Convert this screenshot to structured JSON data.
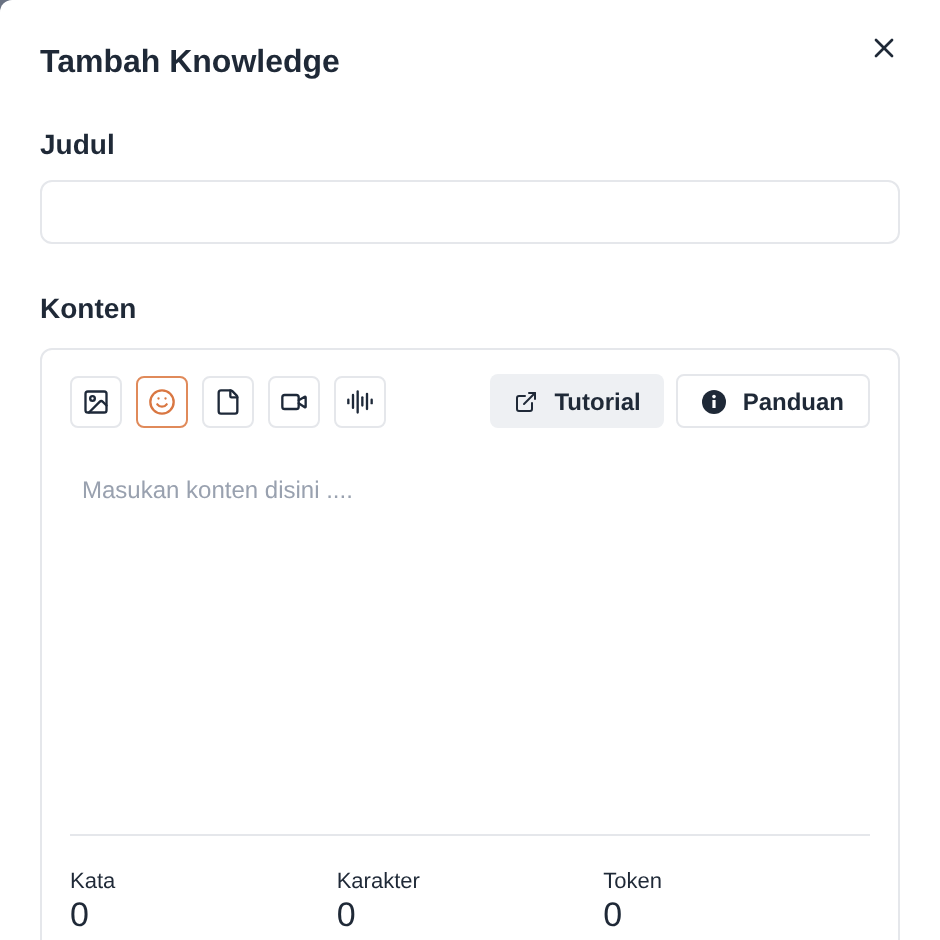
{
  "dialog": {
    "title": "Tambah Knowledge"
  },
  "fields": [
    {
      "label": "Judul"
    }
  ],
  "content": {
    "label": "Konten",
    "placeholder": "Masukan konten disini ....",
    "tools": [
      {
        "kind": "image",
        "selected": false
      },
      {
        "kind": "emoji",
        "selected": true
      },
      {
        "kind": "file",
        "selected": false
      },
      {
        "kind": "video",
        "selected": false
      },
      {
        "kind": "audio",
        "selected": false
      }
    ],
    "buttons": [
      {
        "kind": "tutorial",
        "label": "Tutorial"
      },
      {
        "kind": "guide",
        "label": "Panduan"
      }
    ],
    "stats": [
      {
        "label": "Kata",
        "value": "0"
      },
      {
        "label": "Karakter",
        "value": "0"
      },
      {
        "label": "Token",
        "value": "0"
      }
    ]
  }
}
